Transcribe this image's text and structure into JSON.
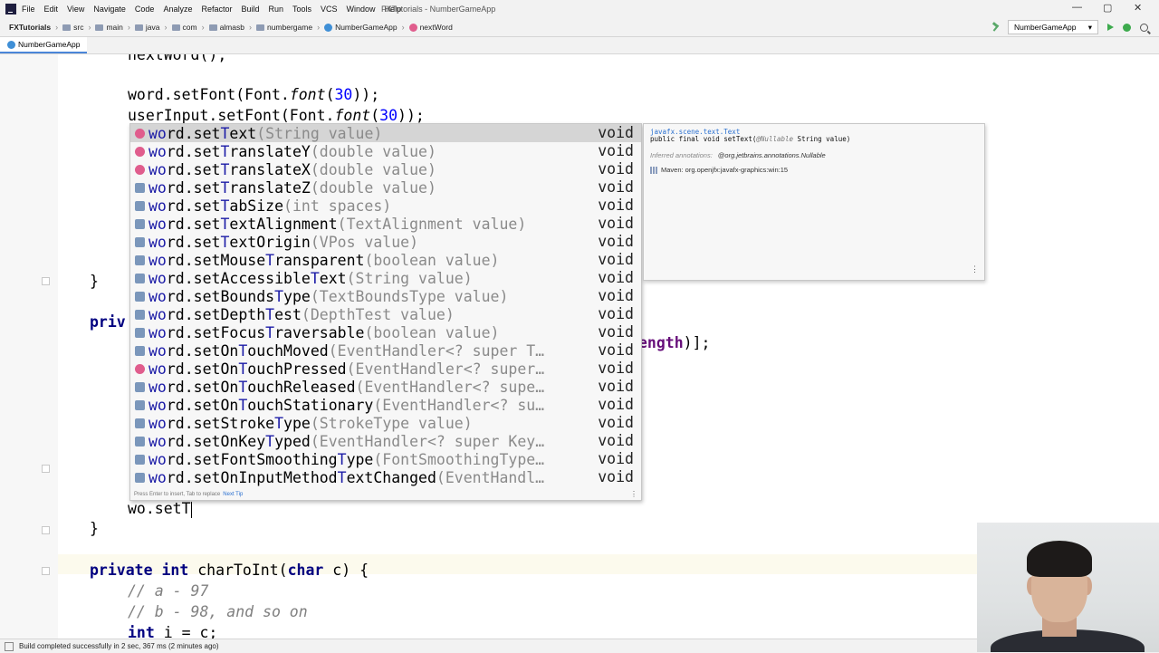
{
  "window": {
    "menu": [
      "File",
      "Edit",
      "View",
      "Navigate",
      "Code",
      "Analyze",
      "Refactor",
      "Build",
      "Run",
      "Tools",
      "VCS",
      "Window",
      "Help"
    ],
    "title": "FXTutorials - NumberGameApp",
    "minimize": "—",
    "maximize": "▢",
    "close": "✕"
  },
  "navbar": {
    "project": "FXTutorials",
    "crumbs": [
      "src",
      "main",
      "java",
      "com",
      "almasb",
      "numbergame"
    ],
    "class_name": "NumberGameApp",
    "method_name": "nextWord",
    "run_config": "NumberGameApp",
    "run_config_arrow": "▾"
  },
  "tab": {
    "label": "NumberGameApp"
  },
  "code": {
    "l1": "nextWord();",
    "l2_obj": "word.setFont(Font.",
    "l2_fn": "font",
    "l2_arg": "30",
    "l2_end": "));",
    "l3_obj": "userInput.setFont(Font.",
    "l3_fn": "font",
    "l3_arg": "30",
    "l3_end": "));",
    "l4": "}",
    "l5_kw": "priv",
    "l6_tail_field": "ength",
    "l6_tail_end": ")];",
    "current": "wo.setT",
    "l8": "}",
    "l9_kw1": "private",
    "l9_kw2": "int",
    "l9_name": " charToInt(",
    "l9_kw3": "char",
    "l9_end": " c) {",
    "l10": "// a - 97",
    "l11": "// b - 98, and so on",
    "l12_kw": "int",
    "l12_rest": " i = c;"
  },
  "completion": {
    "items": [
      {
        "prefix": "wo",
        "mid": "rd.set",
        "match": "T",
        "rest": "ext",
        "params": "(String value)",
        "type": "void",
        "icon": "m"
      },
      {
        "prefix": "wo",
        "mid": "rd.set",
        "match": "T",
        "rest": "ranslateY",
        "params": "(double value)",
        "type": "void",
        "icon": "m"
      },
      {
        "prefix": "wo",
        "mid": "rd.set",
        "match": "T",
        "rest": "ranslateX",
        "params": "(double value)",
        "type": "void",
        "icon": "m"
      },
      {
        "prefix": "wo",
        "mid": "rd.set",
        "match": "T",
        "rest": "ranslateZ",
        "params": "(double value)",
        "type": "void",
        "icon": "f"
      },
      {
        "prefix": "wo",
        "mid": "rd.set",
        "match": "T",
        "rest": "abSize",
        "params": "(int spaces)",
        "type": "void",
        "icon": "f"
      },
      {
        "prefix": "wo",
        "mid": "rd.set",
        "match": "T",
        "rest": "extAlignment",
        "params": "(TextAlignment value)",
        "type": "void",
        "icon": "f"
      },
      {
        "prefix": "wo",
        "mid": "rd.set",
        "match": "T",
        "rest": "extOrigin",
        "params": "(VPos value)",
        "type": "void",
        "icon": "f"
      },
      {
        "prefix": "wo",
        "mid": "rd.setMouse",
        "match": "T",
        "rest": "ransparent",
        "params": "(boolean value)",
        "type": "void",
        "icon": "f"
      },
      {
        "prefix": "wo",
        "mid": "rd.setAccessible",
        "match": "T",
        "rest": "ext",
        "params": "(String value)",
        "type": "void",
        "icon": "f"
      },
      {
        "prefix": "wo",
        "mid": "rd.setBounds",
        "match": "T",
        "rest": "ype",
        "params": "(TextBoundsType value)",
        "type": "void",
        "icon": "f"
      },
      {
        "prefix": "wo",
        "mid": "rd.setDepth",
        "match": "T",
        "rest": "est",
        "params": "(DepthTest value)",
        "type": "void",
        "icon": "f"
      },
      {
        "prefix": "wo",
        "mid": "rd.setFocus",
        "match": "T",
        "rest": "raversable",
        "params": "(boolean value)",
        "type": "void",
        "icon": "f"
      },
      {
        "prefix": "wo",
        "mid": "rd.setOn",
        "match": "T",
        "rest": "ouchMoved",
        "params": "(EventHandler<? super T…",
        "type": "void",
        "icon": "f"
      },
      {
        "prefix": "wo",
        "mid": "rd.setOn",
        "match": "T",
        "rest": "ouchPressed",
        "params": "(EventHandler<? super…",
        "type": "void",
        "icon": "m"
      },
      {
        "prefix": "wo",
        "mid": "rd.setOn",
        "match": "T",
        "rest": "ouchReleased",
        "params": "(EventHandler<? supe…",
        "type": "void",
        "icon": "f"
      },
      {
        "prefix": "wo",
        "mid": "rd.setOn",
        "match": "T",
        "rest": "ouchStationary",
        "params": "(EventHandler<? su…",
        "type": "void",
        "icon": "f"
      },
      {
        "prefix": "wo",
        "mid": "rd.setStroke",
        "match": "T",
        "rest": "ype",
        "params": "(StrokeType value)",
        "type": "void",
        "icon": "f"
      },
      {
        "prefix": "wo",
        "mid": "rd.setOnKey",
        "match": "T",
        "rest": "yped",
        "params": "(EventHandler<? super Key…",
        "type": "void",
        "icon": "f"
      },
      {
        "prefix": "wo",
        "mid": "rd.setFontSmoothing",
        "match": "T",
        "rest": "ype",
        "params": "(FontSmoothingType…",
        "type": "void",
        "icon": "f"
      },
      {
        "prefix": "wo",
        "mid": "rd.setOnInputMethod",
        "match": "T",
        "rest": "extChanged",
        "params": "(EventHandl…",
        "type": "void",
        "icon": "f"
      }
    ],
    "footer_hint": "Press Enter to insert, Tab to replace",
    "next_tip": "Next Tip",
    "menu_glyph": "⋮"
  },
  "doc": {
    "package": "javafx.scene.text.Text",
    "sig_pre": "public final void setText(",
    "sig_annot": "@Nullable",
    "sig_post": " String value)",
    "inferred_label": "Inferred annotations:",
    "inferred_value": "@org.jetbrains.annotations.Nullable",
    "maven": "Maven: org.openjfx:javafx-graphics:win:15",
    "menu_glyph": "⋮"
  },
  "status": {
    "text": "Build completed successfully in 2 sec, 367 ms (2 minutes ago)"
  },
  "colors": {
    "keyword": "#000080",
    "match": "#1a1aa6",
    "selection": "#d5d5d5",
    "tab_underline": "#4a86d8"
  }
}
